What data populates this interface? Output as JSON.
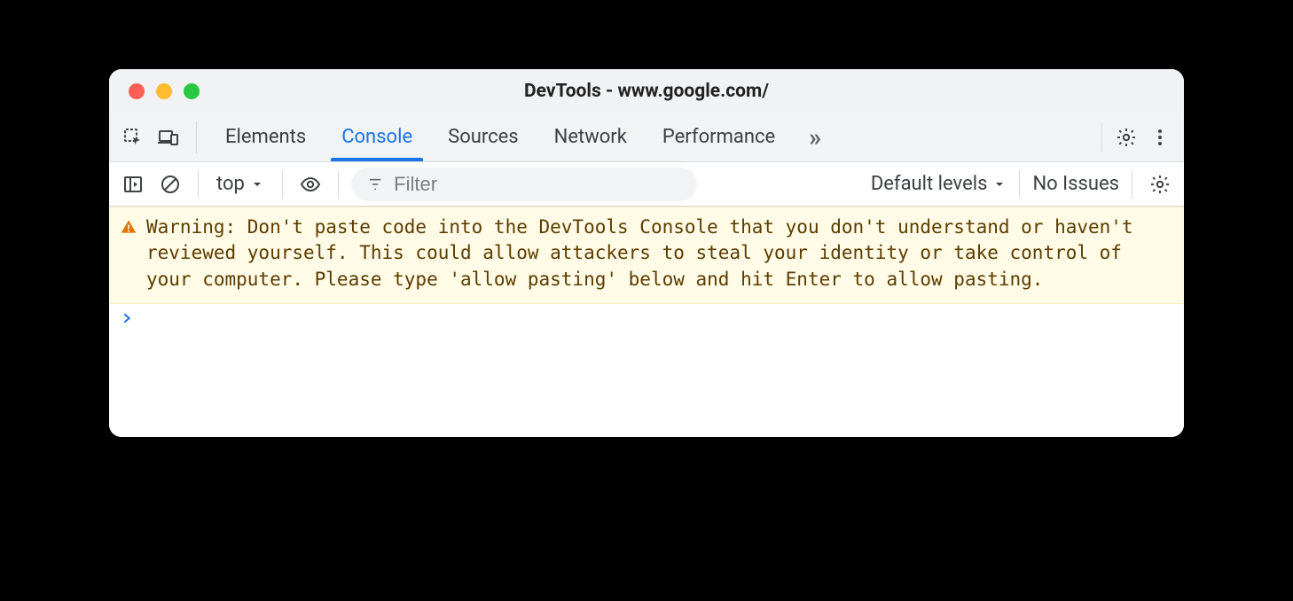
{
  "window": {
    "title": "DevTools - www.google.com/"
  },
  "tabs": {
    "items": [
      "Elements",
      "Console",
      "Sources",
      "Network",
      "Performance"
    ],
    "active_index": 1,
    "more_glyph": "»"
  },
  "toolbar": {
    "context": "top",
    "filter_placeholder": "Filter",
    "levels_label": "Default levels",
    "issues_label": "No Issues"
  },
  "console": {
    "warning": "Warning: Don't paste code into the DevTools Console that you don't understand or haven't reviewed yourself. This could allow attackers to steal your identity or take control of your computer. Please type 'allow pasting' below and hit Enter to allow pasting.",
    "prompt_glyph": "›"
  }
}
